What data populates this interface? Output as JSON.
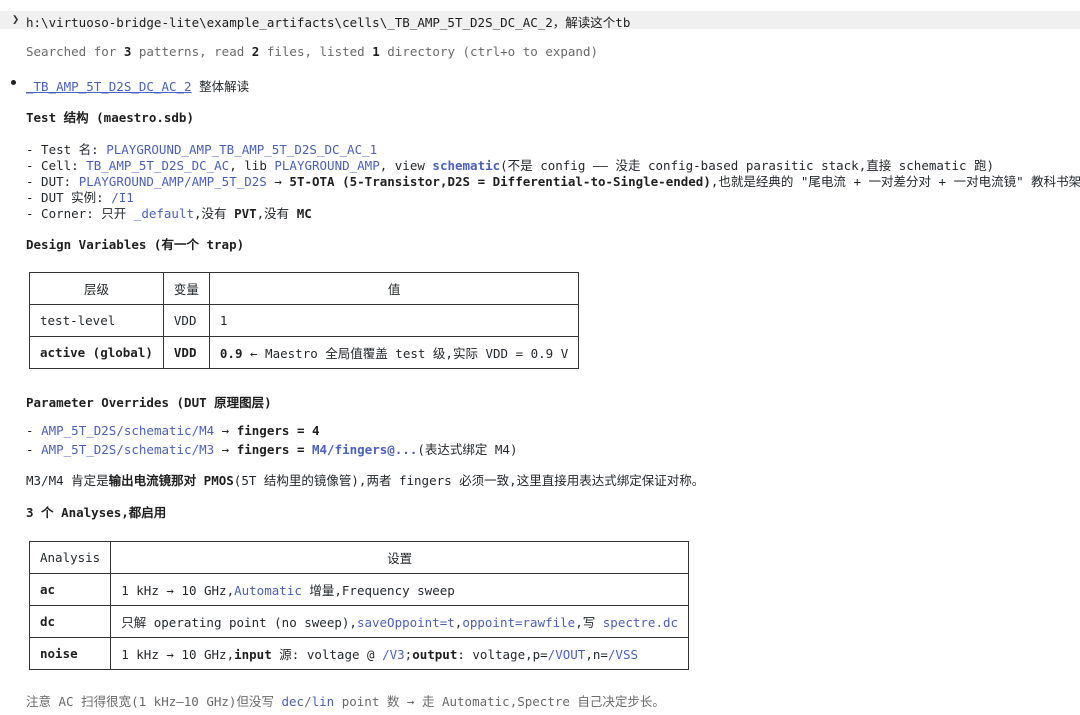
{
  "prompt": {
    "text": "h:\\virtuoso-bridge-lite\\example_artifacts\\cells\\_TB_AMP_5T_D2S_DC_AC_2，解读这个tb"
  },
  "status": {
    "t1": "Searched for ",
    "n1": "3",
    "t2": " patterns, read ",
    "n2": "2",
    "t3": " files, listed ",
    "n3": "1",
    "t4": " directory (ctrl+o to expand)"
  },
  "title": {
    "link": "_TB_AMP_5T_D2S_DC_AC_2",
    "rest": " 整体解读"
  },
  "test_section": {
    "heading": "Test 结构 (maestro.sdb)",
    "test_label": "- Test 名: ",
    "test_value": "PLAYGROUND_AMP_TB_AMP_5T_D2S_DC_AC_1",
    "cell_label": "- Cell: ",
    "cell_value": "TB_AMP_5T_D2S_DC_AC",
    "cell_mid1": ", lib ",
    "cell_lib": "PLAYGROUND_AMP",
    "cell_mid2": ", view ",
    "cell_view": "schematic",
    "cell_rest": "(不是 config —— 没走 config-based parasitic stack,直接 schematic 跑)",
    "dut_label": "- DUT: ",
    "dut_value": "PLAYGROUND_AMP/AMP_5T_D2S",
    "dut_arrow": " → ",
    "dut_bold": "5T-OTA (5-Transistor,D2S = Differential-to-Single-ended)",
    "dut_rest": ",也就是经典的 \"尾电流 + 一对差分对 + 一对电流镜\" 教科书架构",
    "inst_label": "- DUT 实例: ",
    "inst_value": "/I1",
    "corner_label": "- Corner: 只开 ",
    "corner_value": "_default",
    "corner_mid": ",没有 ",
    "corner_pvt": "PVT",
    "corner_mid2": ",没有 ",
    "corner_mc": "MC"
  },
  "design_vars": {
    "heading": "Design Variables (有一个 trap)",
    "headers": [
      "层级",
      "变量",
      "值"
    ],
    "row1": [
      "test-level",
      "VDD",
      "1"
    ],
    "row2_c1": "active (global)",
    "row2_c2": "VDD",
    "row2_val_bold": "0.9",
    "row2_val_rest": " ← Maestro 全局值覆盖 test 级,实际 VDD = 0.9 V"
  },
  "param_overrides": {
    "heading": "Parameter Overrides (DUT 原理图层)",
    "item1_path": "AMP_5T_D2S/schematic/M4",
    "item1_arrow": " → ",
    "item1_bold": "fingers = 4",
    "item2_path": "AMP_5T_D2S/schematic/M3",
    "item2_arrow": " → ",
    "item2_bold": "fingers = ",
    "item2_expr": "M4/fingers@...",
    "item2_rest": "(表达式绑定 M4)",
    "note_a": "M3/M4 肯定是",
    "note_b": "输出电流镜那对 PMOS",
    "note_c": "(5T 结构里的镜像管),两者 fingers 必须一致,这里直接用表达式绑定保证对称。"
  },
  "analyses": {
    "heading": "3 个 Analyses,都启用",
    "headers": [
      "Analysis",
      "设置"
    ],
    "ac_name": "ac",
    "ac_a": "1 kHz → 10 GHz,",
    "ac_link": "Automatic",
    "ac_b": " 增量,Frequency sweep",
    "dc_name": "dc",
    "dc_a": "只解 operating point (no sweep),",
    "dc_link1": "saveOppoint=t",
    "dc_b": ",",
    "dc_link2": "oppoint=rawfile",
    "dc_c": ",写 ",
    "dc_link3": "spectre.dc",
    "noise_name": "noise",
    "noise_a": "1 kHz → 10 GHz,",
    "noise_b1": "input",
    "noise_c": " 源: voltage @ ",
    "noise_link1": "/V3",
    "noise_d": ";",
    "noise_b2": "output",
    "noise_e": ": voltage,p=",
    "noise_link2": "/VOUT",
    "noise_f": ",n=",
    "noise_link3": "/VSS"
  },
  "footer_note": {
    "a": "注意 AC 扫得很宽(1 kHz–10 GHz)但没写 ",
    "link1": "dec",
    "b": "/",
    "link2": "lin",
    "c": " point 数 → 走 Automatic,Spectre 自己决定步长。"
  }
}
